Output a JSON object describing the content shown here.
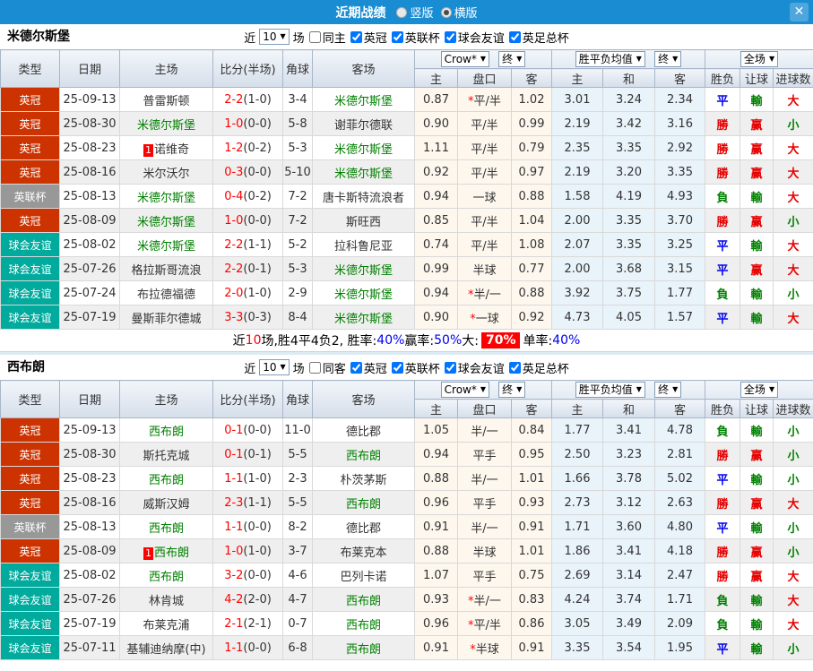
{
  "titlebar": {
    "title": "近期战绩",
    "radio_vertical": "竖版",
    "radio_horizontal": "横版",
    "close": "✕"
  },
  "labels": {
    "near": "近",
    "games": "场"
  },
  "headers": {
    "type": "类型",
    "date": "日期",
    "home": "主场",
    "score": "比分(半场)",
    "corner": "角球",
    "away": "客场",
    "odds_home": "主",
    "odds_hc": "盘口",
    "odds_away": "客",
    "avg_home": "主",
    "avg_draw": "和",
    "avg_away": "客",
    "result": "胜负",
    "handicap_result": "让球",
    "goals": "进球数",
    "crow": "Crow*",
    "final": "终",
    "avg_select": "胜平负均值",
    "full_match": "全场"
  },
  "type_colors": {
    "英冠": "#cc3300",
    "英联杯": "#989898",
    "球会友谊": "#00ab9e"
  },
  "result_colors": {
    "勝": "red",
    "平": "blue",
    "負": "green",
    "赢": "red",
    "輸": "green",
    "大": "red",
    "小": "green"
  },
  "sections": [
    {
      "team": "米德尔斯堡",
      "filter": {
        "count": "10",
        "same": "同主",
        "comps": [
          "英冠",
          "英联杯",
          "球会友谊",
          "英足总杯"
        ]
      },
      "rows": [
        {
          "type": "英冠",
          "date": "25-09-13",
          "home": "普雷斯顿",
          "home_hl": false,
          "home_rank": "",
          "score": "2-2",
          "half": "(1-0)",
          "corner": "3-4",
          "away": "米德尔斯堡",
          "away_hl": true,
          "odds": [
            "0.87",
            "*平/半",
            "1.02"
          ],
          "avg": [
            "3.01",
            "3.24",
            "2.34"
          ],
          "res": [
            "平",
            "輸",
            "大"
          ]
        },
        {
          "type": "英冠",
          "date": "25-08-30",
          "home": "米德尔斯堡",
          "home_hl": true,
          "home_rank": "",
          "score": "1-0",
          "half": "(0-0)",
          "corner": "5-8",
          "away": "谢菲尔德联",
          "away_hl": false,
          "odds": [
            "0.90",
            "平/半",
            "0.99"
          ],
          "avg": [
            "2.19",
            "3.42",
            "3.16"
          ],
          "res": [
            "勝",
            "赢",
            "小"
          ]
        },
        {
          "type": "英冠",
          "date": "25-08-23",
          "home": "诺维奇",
          "home_hl": false,
          "home_rank": "1",
          "score": "1-2",
          "half": "(0-2)",
          "corner": "5-3",
          "away": "米德尔斯堡",
          "away_hl": true,
          "odds": [
            "1.11",
            "平/半",
            "0.79"
          ],
          "avg": [
            "2.35",
            "3.35",
            "2.92"
          ],
          "res": [
            "勝",
            "赢",
            "大"
          ]
        },
        {
          "type": "英冠",
          "date": "25-08-16",
          "home": "米尔沃尔",
          "home_hl": false,
          "home_rank": "",
          "score": "0-3",
          "half": "(0-0)",
          "corner": "5-10",
          "away": "米德尔斯堡",
          "away_hl": true,
          "odds": [
            "0.92",
            "平/半",
            "0.97"
          ],
          "avg": [
            "2.19",
            "3.20",
            "3.35"
          ],
          "res": [
            "勝",
            "赢",
            "大"
          ]
        },
        {
          "type": "英联杯",
          "date": "25-08-13",
          "home": "米德尔斯堡",
          "home_hl": true,
          "home_rank": "",
          "score": "0-4",
          "half": "(0-2)",
          "corner": "7-2",
          "away": "唐卡斯特流浪者",
          "away_hl": false,
          "odds": [
            "0.94",
            "一球",
            "0.88"
          ],
          "avg": [
            "1.58",
            "4.19",
            "4.93"
          ],
          "res": [
            "負",
            "輸",
            "大"
          ]
        },
        {
          "type": "英冠",
          "date": "25-08-09",
          "home": "米德尔斯堡",
          "home_hl": true,
          "home_rank": "",
          "score": "1-0",
          "half": "(0-0)",
          "corner": "7-2",
          "away": "斯旺西",
          "away_hl": false,
          "odds": [
            "0.85",
            "平/半",
            "1.04"
          ],
          "avg": [
            "2.00",
            "3.35",
            "3.70"
          ],
          "res": [
            "勝",
            "赢",
            "小"
          ]
        },
        {
          "type": "球会友谊",
          "date": "25-08-02",
          "home": "米德尔斯堡",
          "home_hl": true,
          "home_rank": "",
          "score": "2-2",
          "half": "(1-1)",
          "corner": "5-2",
          "away": "拉科鲁尼亚",
          "away_hl": false,
          "odds": [
            "0.74",
            "平/半",
            "1.08"
          ],
          "avg": [
            "2.07",
            "3.35",
            "3.25"
          ],
          "res": [
            "平",
            "輸",
            "大"
          ]
        },
        {
          "type": "球会友谊",
          "date": "25-07-26",
          "home": "格拉斯哥流浪",
          "home_hl": false,
          "home_rank": "",
          "score": "2-2",
          "half": "(0-1)",
          "corner": "5-3",
          "away": "米德尔斯堡",
          "away_hl": true,
          "odds": [
            "0.99",
            "半球",
            "0.77"
          ],
          "avg": [
            "2.00",
            "3.68",
            "3.15"
          ],
          "res": [
            "平",
            "赢",
            "大"
          ]
        },
        {
          "type": "球会友谊",
          "date": "25-07-24",
          "home": "布拉德福德",
          "home_hl": false,
          "home_rank": "",
          "score": "2-0",
          "half": "(1-0)",
          "corner": "2-9",
          "away": "米德尔斯堡",
          "away_hl": true,
          "odds": [
            "0.94",
            "*半/一",
            "0.88"
          ],
          "avg": [
            "3.92",
            "3.75",
            "1.77"
          ],
          "res": [
            "負",
            "輸",
            "小"
          ]
        },
        {
          "type": "球会友谊",
          "date": "25-07-19",
          "home": "曼斯菲尔德城",
          "home_hl": false,
          "home_rank": "",
          "score": "3-3",
          "half": "(0-3)",
          "corner": "8-4",
          "away": "米德尔斯堡",
          "away_hl": true,
          "odds": [
            "0.90",
            "*一球",
            "0.92"
          ],
          "avg": [
            "4.73",
            "4.05",
            "1.57"
          ],
          "res": [
            "平",
            "輸",
            "大"
          ]
        }
      ],
      "summary": [
        {
          "t": "近",
          "c": "plain"
        },
        {
          "t": "10",
          "c": "red"
        },
        {
          "t": "场,胜4平4负2, 胜率:",
          "c": "plain"
        },
        {
          "t": "40%",
          "c": "blue"
        },
        {
          "t": " 赢率:",
          "c": "plain"
        },
        {
          "t": "50%",
          "c": "blue"
        },
        {
          "t": " 大:",
          "c": "plain"
        },
        {
          "t": "70%",
          "c": "badge"
        },
        {
          "t": " 单率:",
          "c": "plain"
        },
        {
          "t": "40%",
          "c": "blue"
        }
      ]
    },
    {
      "team": "西布朗",
      "filter": {
        "count": "10",
        "same": "同客",
        "comps": [
          "英冠",
          "英联杯",
          "球会友谊",
          "英足总杯"
        ]
      },
      "rows": [
        {
          "type": "英冠",
          "date": "25-09-13",
          "home": "西布朗",
          "home_hl": true,
          "home_rank": "",
          "score": "0-1",
          "half": "(0-0)",
          "corner": "11-0",
          "away": "德比郡",
          "away_hl": false,
          "odds": [
            "1.05",
            "半/一",
            "0.84"
          ],
          "avg": [
            "1.77",
            "3.41",
            "4.78"
          ],
          "res": [
            "負",
            "輸",
            "小"
          ]
        },
        {
          "type": "英冠",
          "date": "25-08-30",
          "home": "斯托克城",
          "home_hl": false,
          "home_rank": "",
          "score": "0-1",
          "half": "(0-1)",
          "corner": "5-5",
          "away": "西布朗",
          "away_hl": true,
          "odds": [
            "0.94",
            "平手",
            "0.95"
          ],
          "avg": [
            "2.50",
            "3.23",
            "2.81"
          ],
          "res": [
            "勝",
            "赢",
            "小"
          ]
        },
        {
          "type": "英冠",
          "date": "25-08-23",
          "home": "西布朗",
          "home_hl": true,
          "home_rank": "",
          "score": "1-1",
          "half": "(1-0)",
          "corner": "2-3",
          "away": "朴茨茅斯",
          "away_hl": false,
          "odds": [
            "0.88",
            "半/一",
            "1.01"
          ],
          "avg": [
            "1.66",
            "3.78",
            "5.02"
          ],
          "res": [
            "平",
            "輸",
            "小"
          ]
        },
        {
          "type": "英冠",
          "date": "25-08-16",
          "home": "威斯汉姆",
          "home_hl": false,
          "home_rank": "",
          "score": "2-3",
          "half": "(1-1)",
          "corner": "5-5",
          "away": "西布朗",
          "away_hl": true,
          "odds": [
            "0.96",
            "平手",
            "0.93"
          ],
          "avg": [
            "2.73",
            "3.12",
            "2.63"
          ],
          "res": [
            "勝",
            "赢",
            "大"
          ]
        },
        {
          "type": "英联杯",
          "date": "25-08-13",
          "home": "西布朗",
          "home_hl": true,
          "home_rank": "",
          "score": "1-1",
          "half": "(0-0)",
          "corner": "8-2",
          "away": "德比郡",
          "away_hl": false,
          "odds": [
            "0.91",
            "半/一",
            "0.91"
          ],
          "avg": [
            "1.71",
            "3.60",
            "4.80"
          ],
          "res": [
            "平",
            "輸",
            "小"
          ]
        },
        {
          "type": "英冠",
          "date": "25-08-09",
          "home": "西布朗",
          "home_hl": true,
          "home_rank": "1",
          "score": "1-0",
          "half": "(1-0)",
          "corner": "3-7",
          "away": "布莱克本",
          "away_hl": false,
          "odds": [
            "0.88",
            "半球",
            "1.01"
          ],
          "avg": [
            "1.86",
            "3.41",
            "4.18"
          ],
          "res": [
            "勝",
            "赢",
            "小"
          ]
        },
        {
          "type": "球会友谊",
          "date": "25-08-02",
          "home": "西布朗",
          "home_hl": true,
          "home_rank": "",
          "score": "3-2",
          "half": "(0-0)",
          "corner": "4-6",
          "away": "巴列卡诺",
          "away_hl": false,
          "odds": [
            "1.07",
            "平手",
            "0.75"
          ],
          "avg": [
            "2.69",
            "3.14",
            "2.47"
          ],
          "res": [
            "勝",
            "赢",
            "大"
          ]
        },
        {
          "type": "球会友谊",
          "date": "25-07-26",
          "home": "林肯城",
          "home_hl": false,
          "home_rank": "",
          "score": "4-2",
          "half": "(2-0)",
          "corner": "4-7",
          "away": "西布朗",
          "away_hl": true,
          "odds": [
            "0.93",
            "*半/一",
            "0.83"
          ],
          "avg": [
            "4.24",
            "3.74",
            "1.71"
          ],
          "res": [
            "負",
            "輸",
            "大"
          ]
        },
        {
          "type": "球会友谊",
          "date": "25-07-19",
          "home": "布莱克浦",
          "home_hl": false,
          "home_rank": "",
          "score": "2-1",
          "half": "(2-1)",
          "corner": "0-7",
          "away": "西布朗",
          "away_hl": true,
          "odds": [
            "0.96",
            "*平/半",
            "0.86"
          ],
          "avg": [
            "3.05",
            "3.49",
            "2.09"
          ],
          "res": [
            "負",
            "輸",
            "大"
          ]
        },
        {
          "type": "球会友谊",
          "date": "25-07-11",
          "home": "基辅迪纳摩(中)",
          "home_hl": false,
          "home_rank": "",
          "score": "1-1",
          "half": "(0-0)",
          "corner": "6-8",
          "away": "西布朗",
          "away_hl": true,
          "odds": [
            "0.91",
            "*半球",
            "0.91"
          ],
          "avg": [
            "3.35",
            "3.54",
            "1.95"
          ],
          "res": [
            "平",
            "輸",
            "小"
          ]
        }
      ],
      "summary": []
    }
  ]
}
